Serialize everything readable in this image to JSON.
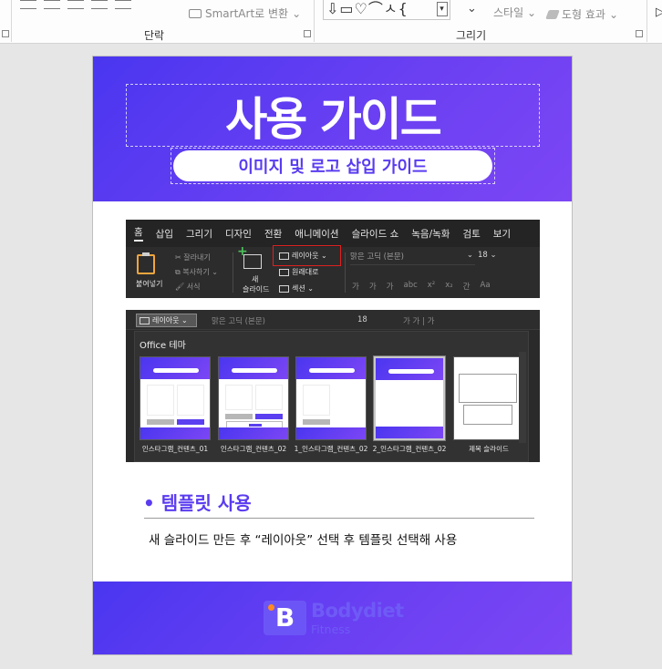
{
  "ribbon": {
    "smartart_label": "SmartArt로 변환",
    "shapes_glyphs": "⇩▭♡⌒ㅅ{",
    "style_label": "스타일",
    "effect_label": "도형 효과",
    "group_paragraph": "단락",
    "group_drawing": "그리기"
  },
  "slide": {
    "title": "사용 가이드",
    "subtitle": "이미지 및 로고 삽입 가이드",
    "shot1": {
      "tabs": [
        "홈",
        "삽입",
        "그리기",
        "디자인",
        "전환",
        "애니메이션",
        "슬라이드 쇼",
        "녹음/녹화",
        "검토",
        "보기"
      ],
      "paste_label": "붙여넣기",
      "cut_label": "잘라내기",
      "copy_label": "복사하기",
      "format_label": "서식",
      "new_slide_label_1": "새",
      "new_slide_label_2": "슬라이드",
      "layout_label": "레이아웃",
      "reset_label": "원래대로",
      "section_label": "섹션",
      "font_name": "맑은 고딕 (본문)",
      "font_size": "18",
      "format_icons": [
        "가",
        "가",
        "가",
        "abc",
        "x²",
        "x₂",
        "간",
        "Aa"
      ]
    },
    "shot2": {
      "layout_button": "레이아웃",
      "font_name": "맑은 고딕 (본문)",
      "font_size": "18",
      "more": "가  가  |  가",
      "panel_title": "Office 테마",
      "thumbs": [
        {
          "caption": "인스타그램_컨텐츠_01"
        },
        {
          "caption": "인스타그램_컨텐츠_02"
        },
        {
          "caption": "1_인스타그램_컨텐츠_02"
        },
        {
          "caption": "2_인스타그램_컨텐츠_02"
        },
        {
          "caption": "제목 슬라이드"
        }
      ]
    },
    "section": {
      "heading": "• 템플릿 사용",
      "description": "새 슬라이드 만든 후 “레이아웃” 선택 후 템플릿 선택해 사용"
    },
    "footer": {
      "logo_letter": "B",
      "brand_name": "Bodydiet",
      "brand_sub": "Fitness"
    }
  }
}
